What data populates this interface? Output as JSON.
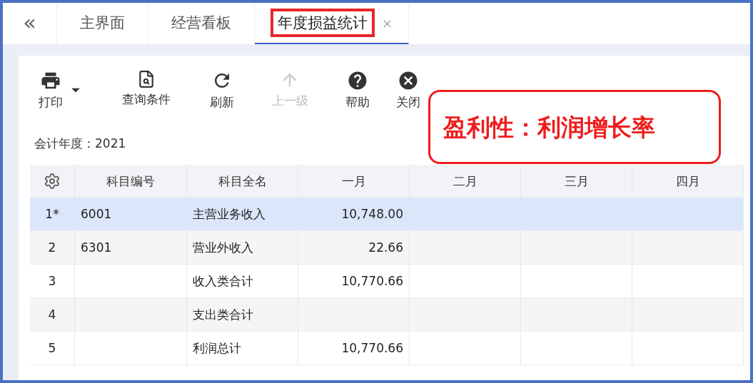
{
  "tabs_nav": {
    "collapse": "«"
  },
  "tabs": [
    {
      "label": "主界面",
      "selected": false,
      "annotated": false
    },
    {
      "label": "经营看板",
      "selected": false,
      "annotated": false
    },
    {
      "label": "年度损益统计",
      "selected": true,
      "annotated": true,
      "close": "×"
    }
  ],
  "toolbar": [
    {
      "kind": "print",
      "label": "打印",
      "dropdown": true,
      "disabled": false
    },
    {
      "kind": "query",
      "label": "查询条件",
      "dropdown": false,
      "disabled": false
    },
    {
      "kind": "refresh",
      "label": "刷新",
      "dropdown": false,
      "disabled": false
    },
    {
      "kind": "up",
      "label": "上一级",
      "dropdown": false,
      "disabled": true
    },
    {
      "kind": "help",
      "label": "帮助",
      "dropdown": false,
      "disabled": false
    },
    {
      "kind": "close",
      "label": "关闭",
      "dropdown": false,
      "disabled": false
    }
  ],
  "fiscal_year": "会计年度：2021",
  "callout": "盈利性：利润增长率",
  "table": {
    "columns": [
      "科目编号",
      "科目全名",
      "一月",
      "二月",
      "三月",
      "四月"
    ],
    "rows": [
      {
        "no": "1*",
        "selected": true,
        "cells": [
          "6001",
          "主营业务收入",
          "10,748.00"
        ]
      },
      {
        "no": "2",
        "selected": false,
        "cells": [
          "6301",
          "营业外收入",
          "22.66"
        ]
      },
      {
        "no": "3",
        "selected": false,
        "cells": [
          null,
          "收入类合计",
          "10,770.66"
        ]
      },
      {
        "no": "4",
        "selected": false,
        "cells": [
          null,
          "支出类合计"
        ]
      },
      {
        "no": "5",
        "selected": false,
        "cells": [
          null,
          "利润总计",
          "10,770.66"
        ]
      }
    ]
  }
}
